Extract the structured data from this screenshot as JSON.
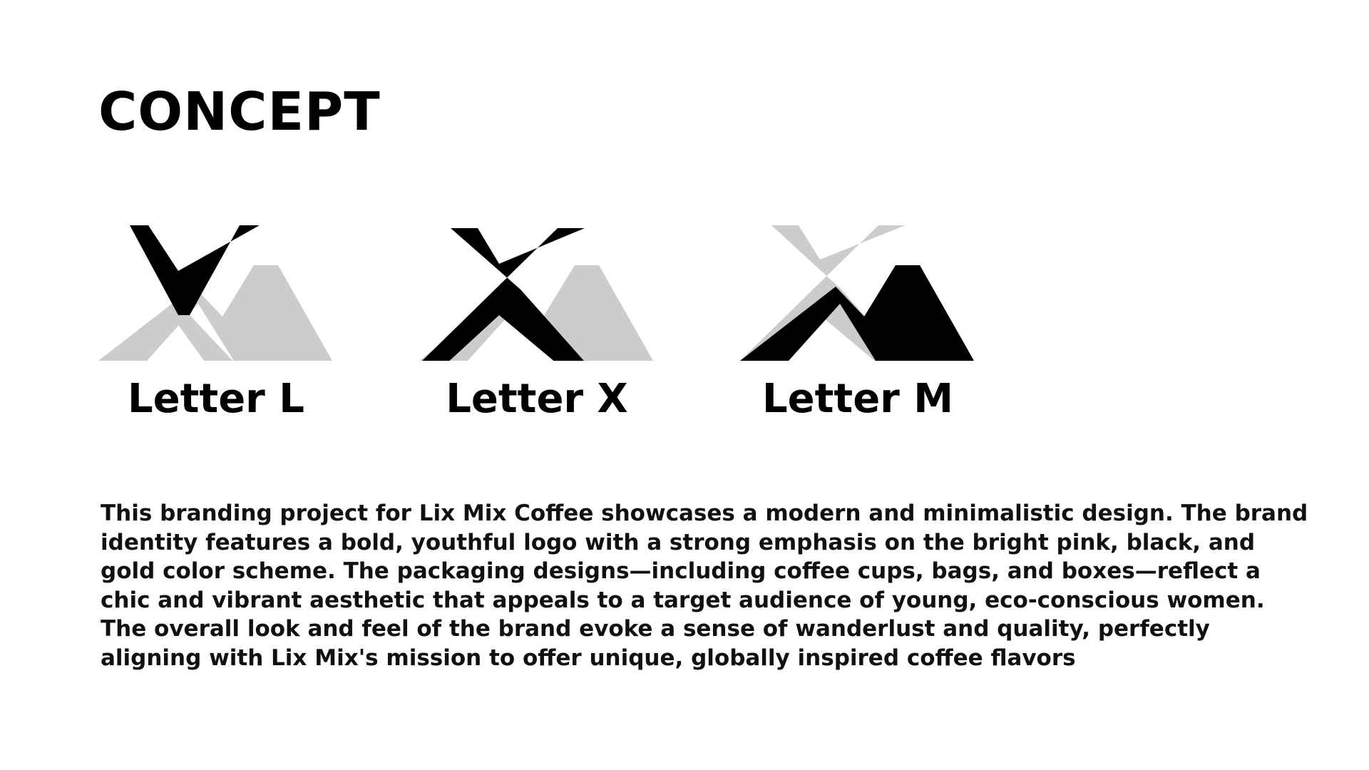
{
  "header": {
    "title": "CONCEPT"
  },
  "concepts": [
    {
      "label": "Letter L",
      "highlight": "letter-l"
    },
    {
      "label": "Letter X",
      "highlight": "letter-x"
    },
    {
      "label": "Letter M",
      "highlight": "letter-m"
    }
  ],
  "colors": {
    "highlight": "#000000",
    "muted": "#cccccc",
    "background": "#ffffff",
    "text": "#111111"
  },
  "description": {
    "text": "This branding project for Lix Mix Coffee showcases a modern and minimalistic design. The brand identity features a bold, youthful logo with a strong emphasis on the bright pink, black, and gold color scheme. The packaging designs—including coffee cups, bags, and boxes—reflect a chic and vibrant aesthetic that appeals to a target audience of young, eco-conscious women. The overall look and feel of the brand evoke a sense of wanderlust and quality, perfectly aligning with Lix Mix's mission to offer unique, globally inspired coffee flavors"
  }
}
